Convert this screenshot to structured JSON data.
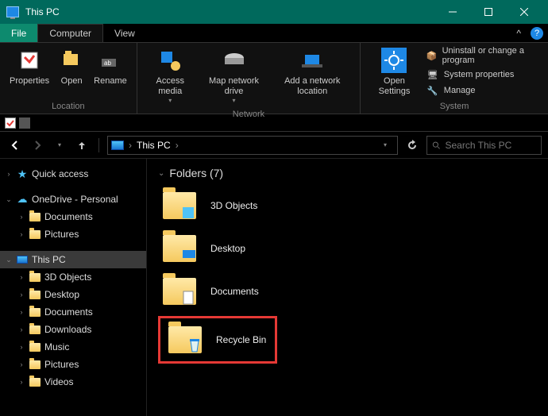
{
  "window": {
    "title": "This PC"
  },
  "tabs": {
    "file": "File",
    "computer": "Computer",
    "view": "View"
  },
  "ribbon": {
    "location": {
      "label": "Location",
      "properties": "Properties",
      "open": "Open",
      "rename": "Rename"
    },
    "network": {
      "label": "Network",
      "access_media": "Access media",
      "map_drive": "Map network drive",
      "add_location": "Add a network location"
    },
    "system": {
      "label": "System",
      "open_settings": "Open Settings",
      "uninstall": "Uninstall or change a program",
      "sysprops": "System properties",
      "manage": "Manage"
    }
  },
  "address": {
    "crumb": "This PC",
    "search_placeholder": "Search This PC"
  },
  "nav": {
    "quick_access": "Quick access",
    "onedrive": "OneDrive - Personal",
    "onedrive_children": [
      "Documents",
      "Pictures"
    ],
    "this_pc": "This PC",
    "pc_children": [
      "3D Objects",
      "Desktop",
      "Documents",
      "Downloads",
      "Music",
      "Pictures",
      "Videos"
    ]
  },
  "content": {
    "group_label": "Folders (7)",
    "items": [
      {
        "name": "3D Objects"
      },
      {
        "name": "Desktop"
      },
      {
        "name": "Documents"
      },
      {
        "name": "Recycle Bin",
        "highlighted": true
      }
    ]
  }
}
